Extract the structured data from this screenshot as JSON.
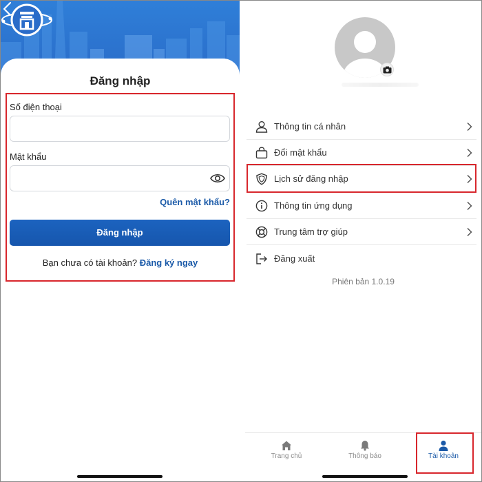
{
  "login_screen": {
    "title": "Đăng nhập",
    "phone_label": "Số điện thoại",
    "phone_value": "",
    "password_label": "Mật khẩu",
    "password_value": "",
    "forgot_password": "Quên mật khẩu?",
    "login_button": "Đăng nhập",
    "signup_prompt": "Bạn chưa có tài khoản?",
    "signup_link": "Đăng ký ngay"
  },
  "account_screen": {
    "menu": [
      {
        "label": "Thông tin cá nhân",
        "icon": "user-icon"
      },
      {
        "label": "Đổi mật khẩu",
        "icon": "bag-icon"
      },
      {
        "label": "Lịch sử đăng nhập",
        "icon": "shield-icon"
      },
      {
        "label": "Thông tin ứng dụng",
        "icon": "info-icon"
      },
      {
        "label": "Trung tâm trợ giúp",
        "icon": "lifebuoy-icon"
      },
      {
        "label": "Đăng xuất",
        "icon": "logout-icon"
      }
    ],
    "version": "Phiên bản 1.0.19",
    "tabs": [
      {
        "label": "Trang chủ",
        "icon": "home-icon",
        "active": false
      },
      {
        "label": "Thông báo",
        "icon": "bell-icon",
        "active": false
      },
      {
        "label": "Tài khoản",
        "icon": "person-icon",
        "active": true
      }
    ]
  },
  "colors": {
    "brand_blue": "#1b5aa8",
    "button_blue": "#1c63bf",
    "header_blue": "#2f7fd8",
    "highlight_red": "#d8262c",
    "inactive_gray": "#8a8a8a"
  }
}
